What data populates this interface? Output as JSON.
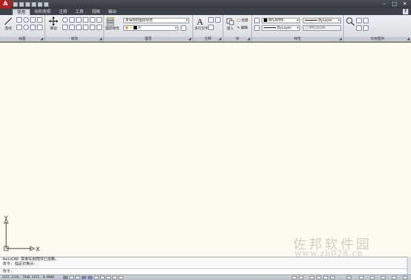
{
  "app": {
    "logo_letter": "A"
  },
  "tabs": [
    "常用",
    "块和参照",
    "注释",
    "工具",
    "视图",
    "输出"
  ],
  "active_tab": 0,
  "help_label": "?",
  "ribbon": {
    "draw": {
      "title": "绘图",
      "line_label": "直线"
    },
    "modify": {
      "title": "修改",
      "move_label": "移动"
    },
    "layers": {
      "title": "图层",
      "props_label": "图层特性",
      "layer_state": "未保存的图层状态",
      "current_layer": "0"
    },
    "annotation": {
      "title": "注释",
      "mtext_label": "多行文字"
    },
    "block": {
      "title": "块",
      "insert_label": "插入",
      "create_label": "创建",
      "edit_label": "编辑"
    },
    "properties": {
      "title": "特性",
      "color": "BYLAYER",
      "linetype": "ByLayer",
      "lineweight": "ByLayer",
      "plotstyle": "BYCOLOR"
    },
    "utilities": {
      "title": "实用程序"
    }
  },
  "ucs": {
    "x_label": "X",
    "y_label": "Y"
  },
  "watermark": {
    "cn": "佐邦软件园",
    "url": "www.zb028.cn"
  },
  "command": {
    "history": [
      "AutoCAD 菜单实用程序已加载。",
      "命令: 指定对角点:"
    ],
    "prompt": "命令:"
  },
  "status": {
    "coordinates": "2352.2226, 1940.1435, 0.0000"
  },
  "colors": {
    "canvas": "#fdfbee",
    "app_red": "#b01e1e"
  }
}
